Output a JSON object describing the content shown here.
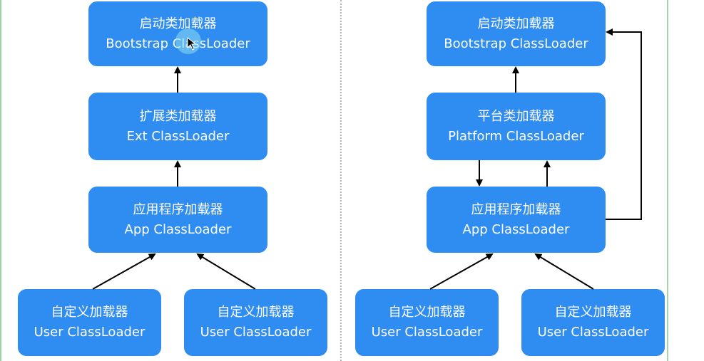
{
  "left_diagram": {
    "bootstrap": {
      "zh": "启动类加载器",
      "en": "Bootstrap ClassLoader"
    },
    "ext": {
      "zh": "扩展类加载器",
      "en": "Ext ClassLoader"
    },
    "app": {
      "zh": "应用程序加载器",
      "en": "App ClassLoader"
    },
    "user1": {
      "zh": "自定义加载器",
      "en": "User ClassLoader"
    },
    "user2": {
      "zh": "自定义加载器",
      "en": "User ClassLoader"
    }
  },
  "right_diagram": {
    "bootstrap": {
      "zh": "启动类加载器",
      "en": "Bootstrap ClassLoader"
    },
    "platform": {
      "zh": "平台类加载器",
      "en": "Platform ClassLoader"
    },
    "app": {
      "zh": "应用程序加载器",
      "en": "App ClassLoader"
    },
    "user1": {
      "zh": "自定义加载器",
      "en": "User ClassLoader"
    },
    "user2": {
      "zh": "自定义加载器",
      "en": "User ClassLoader"
    }
  },
  "colors": {
    "node_fill": "#2f8cf0",
    "node_text": "#ffffff",
    "arrow": "#000000",
    "cursor_halo": "#8cdcf0"
  }
}
